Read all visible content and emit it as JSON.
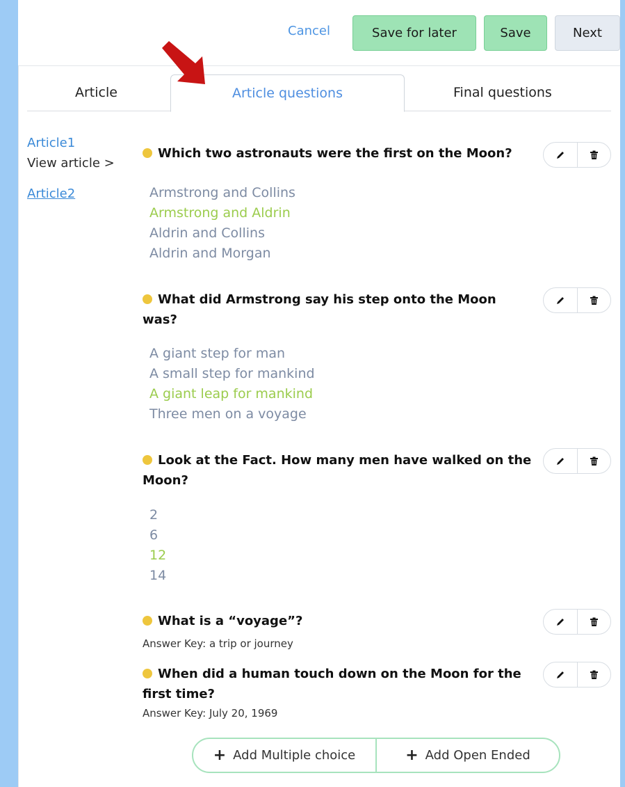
{
  "toolbar": {
    "cancel_label": "Cancel",
    "save_later_label": "Save for later",
    "save_label": "Save",
    "next_label": "Next"
  },
  "tabs": [
    {
      "label": "Article"
    },
    {
      "label": "Article questions"
    },
    {
      "label": "Final questions"
    }
  ],
  "sidebar": {
    "article1": "Article1",
    "view_article": "View article >",
    "article2": "Article2"
  },
  "questions": [
    {
      "title": "Which two astronauts were the first on the Moon?",
      "options": [
        "Armstrong and Collins",
        "Armstrong and Aldrin",
        "Aldrin and Collins",
        "Aldrin and Morgan"
      ],
      "correct_index": 1
    },
    {
      "title": "What did Armstrong say his step onto the Moon was?",
      "options": [
        "A giant step for man",
        "A small step for mankind",
        "A giant leap for mankind",
        "Three men on a voyage"
      ],
      "correct_index": 2
    },
    {
      "title": "Look at the Fact. How many men have walked on the Moon?",
      "options": [
        "2",
        "6",
        "12",
        "14"
      ],
      "correct_index": 2
    },
    {
      "title": "What is a “voyage”?",
      "answer_key": "Answer Key: a trip or journey"
    },
    {
      "title": "When did a human touch down on the Moon for the first time?",
      "answer_key": "Answer Key: July 20, 1969"
    }
  ],
  "add_buttons": {
    "multiple_choice": "Add Multiple choice",
    "open_ended": "Add Open Ended"
  },
  "colors": {
    "background": "#9dcbf5",
    "primary_button": "#9ee3b5",
    "link": "#4e8ee0",
    "correct_answer": "#9bcc4d",
    "option_text": "#7d8ba3",
    "question_dot": "#eec63d",
    "arrow": "#c81414"
  },
  "icons": {
    "edit": "pencil-icon",
    "delete": "trash-icon",
    "annotation": "red-arrow"
  }
}
